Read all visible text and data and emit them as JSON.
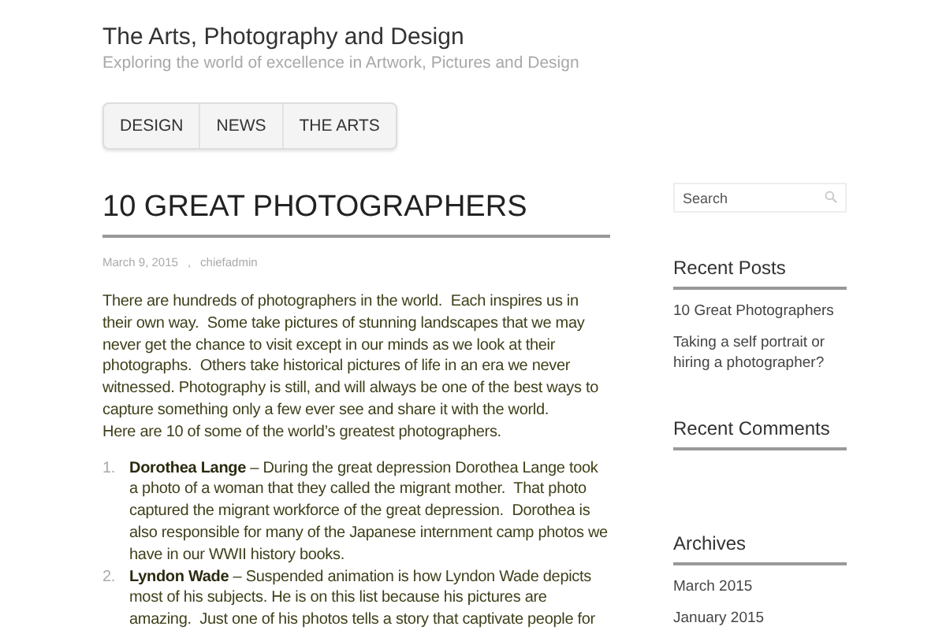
{
  "site": {
    "title": "The Arts, Photography and Design",
    "tagline": "Exploring the world of excellence in Artwork, Pictures and Design"
  },
  "nav": [
    {
      "label": "DESIGN"
    },
    {
      "label": "NEWS"
    },
    {
      "label": "THE ARTS"
    }
  ],
  "post": {
    "title": "10 GREAT PHOTOGRAPHERS",
    "date": "March 9, 2015",
    "separator": ",",
    "author": "chiefadmin",
    "intro": "There are hundreds of photographers in the world.  Each inspires us in their own way.  Some take pictures of stunning landscapes that we may never get the chance to visit except in our minds as we look at their photographs.  Others take historical pictures of life in an era we never witnessed. Photography is still, and will always be one of the best ways to capture something only a few ever see and share it with the world.",
    "intro_2": "Here are 10 of some of the world’s greatest photographers.",
    "list": [
      {
        "number": "1.",
        "text": "**Dorothea Lange** – During the great depression Dorothea Lange took a photo of a woman that they called the migrant mother.  That photo captured the migrant workforce of the great depression.  Dorothea is also responsible for many of the Japanese internment camp photos we have in our WWII history books."
      },
      {
        "number": "2.",
        "text": "**Lyndon Wade** – Suspended animation is how Lyndon Wade depicts most of his subjects. He is on this list because his pictures are amazing.  Just one of his photos tells a story that captivate people for"
      }
    ]
  },
  "sidebar": {
    "search": {
      "placeholder": "Search"
    },
    "widgets": [
      {
        "title": "Recent Posts",
        "links": [
          "10 Great Photographers",
          "Taking a self portrait or hiring a photographer?"
        ]
      },
      {
        "title": "Recent Comments"
      },
      {
        "title": "Archives",
        "links": [
          "March 2015",
          "January 2015"
        ]
      }
    ]
  }
}
